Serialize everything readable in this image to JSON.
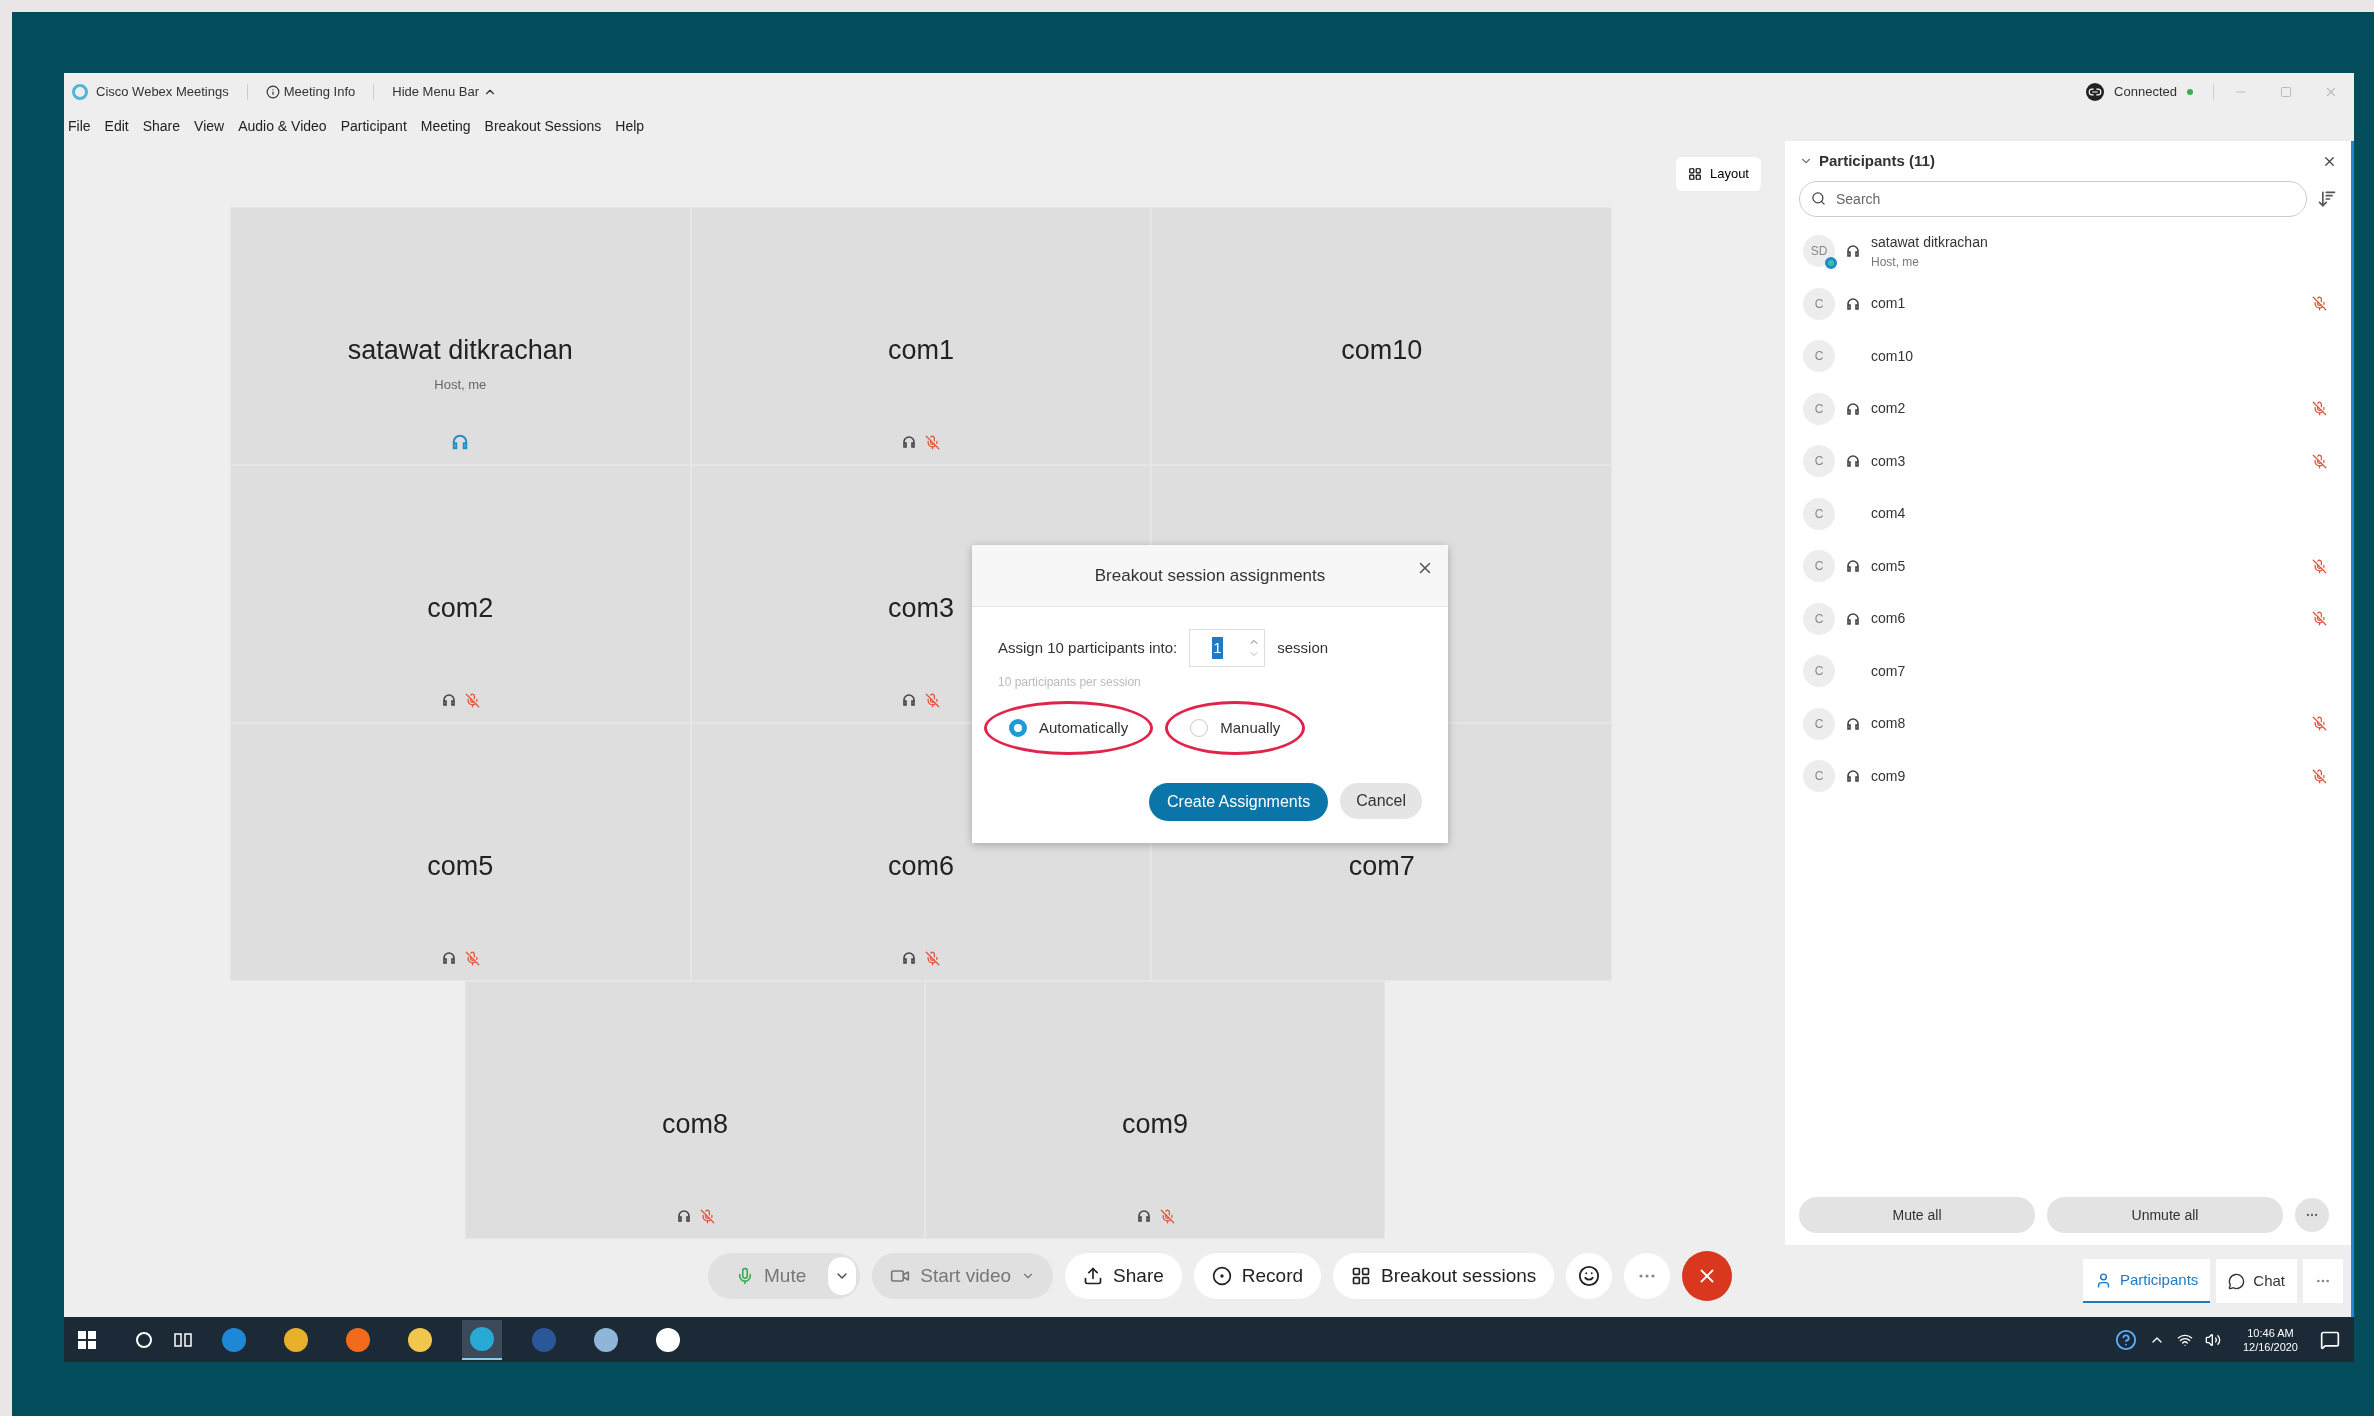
{
  "title_bar": {
    "app_name": "Cisco Webex Meetings",
    "meeting_info": "Meeting Info",
    "hide_menu": "Hide Menu Bar",
    "status": "Connected"
  },
  "menu": [
    "File",
    "Edit",
    "Share",
    "View",
    "Audio & Video",
    "Participant",
    "Meeting",
    "Breakout Sessions",
    "Help"
  ],
  "layout_button": "Layout",
  "tiles": [
    {
      "kind": "person",
      "name": "satawat ditkrachan",
      "subtitle": "Host, me",
      "host": true,
      "audio": true,
      "muted": false
    },
    {
      "kind": "person",
      "name": "com1",
      "host": false,
      "audio": true,
      "muted": true
    },
    {
      "kind": "person",
      "name": "com10",
      "audio": false,
      "muted": false
    },
    {
      "kind": "person",
      "name": "com2",
      "host": false,
      "audio": true,
      "muted": true
    },
    {
      "kind": "person",
      "name": "com3",
      "host": false,
      "audio": true,
      "muted": true
    },
    {
      "kind": "covered"
    },
    {
      "kind": "person",
      "name": "com5",
      "host": false,
      "audio": true,
      "muted": true
    },
    {
      "kind": "person",
      "name": "com6",
      "host": false,
      "audio": true,
      "muted": true
    },
    {
      "kind": "person",
      "name": "com7",
      "audio": false,
      "muted": false
    },
    {
      "kind": "person",
      "name": "com8",
      "host": false,
      "audio": true,
      "muted": true
    },
    {
      "kind": "person",
      "name": "com9",
      "host": false,
      "audio": true,
      "muted": true
    }
  ],
  "dialog": {
    "title": "Breakout session assignments",
    "assign_label": "Assign 10 participants into:",
    "sessions_value": "1",
    "sessions_unit": "session",
    "hint": "10 participants per session",
    "options": [
      {
        "label": "Automatically",
        "selected": true
      },
      {
        "label": "Manually",
        "selected": false
      }
    ],
    "primary_button": "Create Assignments",
    "cancel_button": "Cancel"
  },
  "toolbar": [
    {
      "kind": "mute",
      "label": "Mute",
      "disabled": true
    },
    {
      "kind": "video",
      "label": "Start video",
      "disabled": true
    },
    {
      "kind": "share",
      "label": "Share",
      "disabled": false
    },
    {
      "kind": "record",
      "label": "Record",
      "disabled": false
    },
    {
      "kind": "breakout",
      "label": "Breakout sessions",
      "disabled": false
    },
    {
      "kind": "reactions",
      "disabled": false
    },
    {
      "kind": "more",
      "disabled": false
    },
    {
      "kind": "end",
      "disabled": false
    }
  ],
  "participants_panel": {
    "title": "Participants (11)",
    "search": {
      "placeholder": "Search"
    },
    "participants": [
      {
        "initials": "SD",
        "name": "satawat ditkrachan",
        "subtitle": "Host, me",
        "host": true,
        "audio": true,
        "muted": false
      },
      {
        "initials": "C",
        "name": "com1",
        "host": false,
        "audio": true,
        "muted": true
      },
      {
        "initials": "C",
        "name": "com10",
        "host": false,
        "audio": false,
        "muted": false
      },
      {
        "initials": "C",
        "name": "com2",
        "host": false,
        "audio": true,
        "muted": true
      },
      {
        "initials": "C",
        "name": "com3",
        "host": false,
        "audio": true,
        "muted": true
      },
      {
        "initials": "C",
        "name": "com4",
        "host": false,
        "audio": false,
        "muted": false
      },
      {
        "initials": "C",
        "name": "com5",
        "host": false,
        "audio": true,
        "muted": true
      },
      {
        "initials": "C",
        "name": "com6",
        "host": false,
        "audio": true,
        "muted": true
      },
      {
        "initials": "C",
        "name": "com7",
        "host": false,
        "audio": false,
        "muted": false
      },
      {
        "initials": "C",
        "name": "com8",
        "host": false,
        "audio": true,
        "muted": true
      },
      {
        "initials": "C",
        "name": "com9",
        "host": false,
        "audio": true,
        "muted": true
      }
    ],
    "mute_all": "Mute all",
    "unmute_all": "Unmute all"
  },
  "panel_tabs": [
    {
      "kind": "participants",
      "label": "Participants",
      "selected": true
    },
    {
      "kind": "chat",
      "label": "Chat",
      "selected": false
    }
  ],
  "taskbar": {
    "apps": [
      {
        "color": "#1e88d6",
        "selected": false
      },
      {
        "color": "#e8b02a",
        "selected": false
      },
      {
        "color": "#f26b1d",
        "selected": false
      },
      {
        "color": "#f2c64b",
        "selected": false
      },
      {
        "color": "#29a9d6",
        "selected": true
      },
      {
        "color": "#2b579a",
        "selected": false
      },
      {
        "color": "#8fb6d8",
        "selected": false
      },
      {
        "color": "#ffffff",
        "selected": false
      }
    ],
    "time": "10:46 AM",
    "date": "12/16/2020"
  }
}
